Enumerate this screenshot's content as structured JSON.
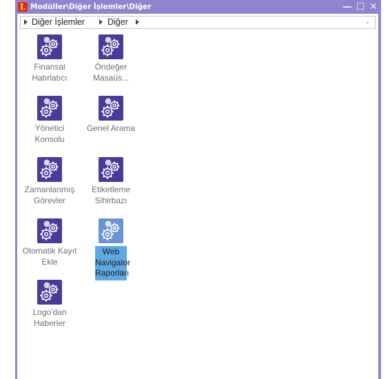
{
  "window": {
    "title": "Modüller\\Diğer İşlemler\\Diğer",
    "logo_letter": "L",
    "minimize_symbol": "—",
    "maximize_symbol": "☐",
    "close_symbol": "✕"
  },
  "breadcrumb": {
    "items": [
      "Diğer İşlemler",
      "Diğer"
    ],
    "dropdown_symbol": "⌄"
  },
  "items": [
    {
      "label": "Finansal Hatırlatıcı"
    },
    {
      "label": "Öndeğer Masaüs..."
    },
    {
      "label": "Yönetici Konsolu"
    },
    {
      "label": "Genel Arama"
    },
    {
      "label": "Zamanlanmış Görevler"
    },
    {
      "label": "Etiketleme Sihirbazı"
    },
    {
      "label": "Otomatik Kayıt Ekle"
    },
    {
      "label": "Web Navigator Raporları",
      "selected": true
    },
    {
      "label": "Logo'dan Haberler"
    }
  ],
  "colors": {
    "titlebar": "#8f85cf",
    "icon_tile": "#4b3a9a",
    "selected_icon_tile": "#6a93d6",
    "selection_highlight": "#5da9e4"
  },
  "icons": {
    "item_icon": "gears-icon",
    "logo": "app-logo-icon"
  }
}
